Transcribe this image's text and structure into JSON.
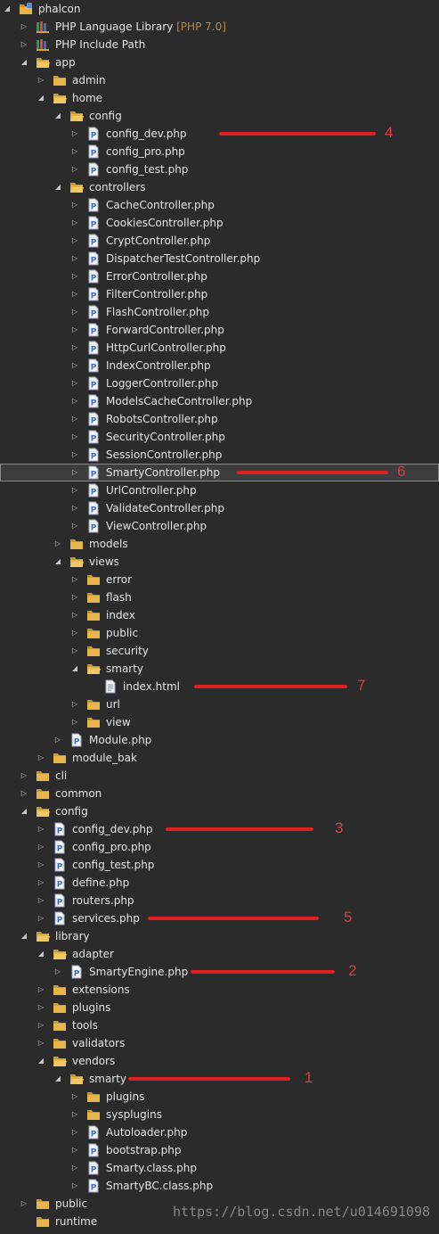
{
  "tree": [
    {
      "label": "phalcon",
      "depth": 0,
      "arrow": "open",
      "icon": "project"
    },
    {
      "label": "PHP Language Library",
      "extra": "[PHP 7.0]",
      "depth": 1,
      "arrow": "closed",
      "icon": "library"
    },
    {
      "label": "PHP Include Path",
      "depth": 1,
      "arrow": "closed",
      "icon": "library"
    },
    {
      "label": "app",
      "depth": 1,
      "arrow": "open",
      "icon": "folder-open"
    },
    {
      "label": "admin",
      "depth": 2,
      "arrow": "closed",
      "icon": "folder"
    },
    {
      "label": "home",
      "depth": 2,
      "arrow": "open",
      "icon": "folder-open"
    },
    {
      "label": "config",
      "depth": 3,
      "arrow": "open",
      "icon": "folder-open"
    },
    {
      "label": "config_dev.php",
      "depth": 4,
      "arrow": "closed",
      "icon": "php"
    },
    {
      "label": "config_pro.php",
      "depth": 4,
      "arrow": "closed",
      "icon": "php"
    },
    {
      "label": "config_test.php",
      "depth": 4,
      "arrow": "closed",
      "icon": "php"
    },
    {
      "label": "controllers",
      "depth": 3,
      "arrow": "open",
      "icon": "folder-open"
    },
    {
      "label": "CacheController.php",
      "depth": 4,
      "arrow": "closed",
      "icon": "php"
    },
    {
      "label": "CookiesController.php",
      "depth": 4,
      "arrow": "closed",
      "icon": "php"
    },
    {
      "label": "CryptController.php",
      "depth": 4,
      "arrow": "closed",
      "icon": "php"
    },
    {
      "label": "DispatcherTestController.php",
      "depth": 4,
      "arrow": "closed",
      "icon": "php"
    },
    {
      "label": "ErrorController.php",
      "depth": 4,
      "arrow": "closed",
      "icon": "php"
    },
    {
      "label": "FilterController.php",
      "depth": 4,
      "arrow": "closed",
      "icon": "php"
    },
    {
      "label": "FlashController.php",
      "depth": 4,
      "arrow": "closed",
      "icon": "php"
    },
    {
      "label": "ForwardController.php",
      "depth": 4,
      "arrow": "closed",
      "icon": "php"
    },
    {
      "label": "HttpCurlController.php",
      "depth": 4,
      "arrow": "closed",
      "icon": "php"
    },
    {
      "label": "IndexController.php",
      "depth": 4,
      "arrow": "closed",
      "icon": "php"
    },
    {
      "label": "LoggerController.php",
      "depth": 4,
      "arrow": "closed",
      "icon": "php"
    },
    {
      "label": "ModelsCacheController.php",
      "depth": 4,
      "arrow": "closed",
      "icon": "php"
    },
    {
      "label": "RobotsController.php",
      "depth": 4,
      "arrow": "closed",
      "icon": "php"
    },
    {
      "label": "SecurityController.php",
      "depth": 4,
      "arrow": "closed",
      "icon": "php"
    },
    {
      "label": "SessionController.php",
      "depth": 4,
      "arrow": "closed",
      "icon": "php"
    },
    {
      "label": "SmartyController.php",
      "depth": 4,
      "arrow": "closed",
      "icon": "php",
      "selected": true
    },
    {
      "label": "UrlController.php",
      "depth": 4,
      "arrow": "closed",
      "icon": "php"
    },
    {
      "label": "ValidateController.php",
      "depth": 4,
      "arrow": "closed",
      "icon": "php"
    },
    {
      "label": "ViewController.php",
      "depth": 4,
      "arrow": "closed",
      "icon": "php"
    },
    {
      "label": "models",
      "depth": 3,
      "arrow": "closed",
      "icon": "folder"
    },
    {
      "label": "views",
      "depth": 3,
      "arrow": "open",
      "icon": "folder-open"
    },
    {
      "label": "error",
      "depth": 4,
      "arrow": "closed",
      "icon": "folder"
    },
    {
      "label": "flash",
      "depth": 4,
      "arrow": "closed",
      "icon": "folder"
    },
    {
      "label": "index",
      "depth": 4,
      "arrow": "closed",
      "icon": "folder"
    },
    {
      "label": "public",
      "depth": 4,
      "arrow": "closed",
      "icon": "folder"
    },
    {
      "label": "security",
      "depth": 4,
      "arrow": "closed",
      "icon": "folder"
    },
    {
      "label": "smarty",
      "depth": 4,
      "arrow": "open",
      "icon": "folder-open"
    },
    {
      "label": "index.html",
      "depth": 5,
      "arrow": "none",
      "icon": "html"
    },
    {
      "label": "url",
      "depth": 4,
      "arrow": "closed",
      "icon": "folder"
    },
    {
      "label": "view",
      "depth": 4,
      "arrow": "closed",
      "icon": "folder"
    },
    {
      "label": "Module.php",
      "depth": 3,
      "arrow": "closed",
      "icon": "php"
    },
    {
      "label": "module_bak",
      "depth": 2,
      "arrow": "closed",
      "icon": "folder"
    },
    {
      "label": "cli",
      "depth": 1,
      "arrow": "closed",
      "icon": "folder"
    },
    {
      "label": "common",
      "depth": 1,
      "arrow": "closed",
      "icon": "folder"
    },
    {
      "label": "config",
      "depth": 1,
      "arrow": "open",
      "icon": "folder-open"
    },
    {
      "label": "config_dev.php",
      "depth": 2,
      "arrow": "closed",
      "icon": "php"
    },
    {
      "label": "config_pro.php",
      "depth": 2,
      "arrow": "closed",
      "icon": "php"
    },
    {
      "label": "config_test.php",
      "depth": 2,
      "arrow": "closed",
      "icon": "php"
    },
    {
      "label": "define.php",
      "depth": 2,
      "arrow": "closed",
      "icon": "php"
    },
    {
      "label": "routers.php",
      "depth": 2,
      "arrow": "closed",
      "icon": "php"
    },
    {
      "label": "services.php",
      "depth": 2,
      "arrow": "closed",
      "icon": "php"
    },
    {
      "label": "library",
      "depth": 1,
      "arrow": "open",
      "icon": "folder-open"
    },
    {
      "label": "adapter",
      "depth": 2,
      "arrow": "open",
      "icon": "folder-open"
    },
    {
      "label": "SmartyEngine.php",
      "depth": 3,
      "arrow": "closed",
      "icon": "php"
    },
    {
      "label": "extensions",
      "depth": 2,
      "arrow": "closed",
      "icon": "folder"
    },
    {
      "label": "plugins",
      "depth": 2,
      "arrow": "closed",
      "icon": "folder"
    },
    {
      "label": "tools",
      "depth": 2,
      "arrow": "closed",
      "icon": "folder"
    },
    {
      "label": "validators",
      "depth": 2,
      "arrow": "closed",
      "icon": "folder"
    },
    {
      "label": "vendors",
      "depth": 2,
      "arrow": "open",
      "icon": "folder-open"
    },
    {
      "label": "smarty",
      "depth": 3,
      "arrow": "open",
      "icon": "folder-open"
    },
    {
      "label": "plugins",
      "depth": 4,
      "arrow": "closed",
      "icon": "folder"
    },
    {
      "label": "sysplugins",
      "depth": 4,
      "arrow": "closed",
      "icon": "folder"
    },
    {
      "label": "Autoloader.php",
      "depth": 4,
      "arrow": "closed",
      "icon": "php"
    },
    {
      "label": "bootstrap.php",
      "depth": 4,
      "arrow": "closed",
      "icon": "php"
    },
    {
      "label": "Smarty.class.php",
      "depth": 4,
      "arrow": "closed",
      "icon": "php"
    },
    {
      "label": "SmartyBC.class.php",
      "depth": 4,
      "arrow": "closed",
      "icon": "php"
    },
    {
      "label": "public",
      "depth": 1,
      "arrow": "closed",
      "icon": "folder"
    },
    {
      "label": "runtime",
      "depth": 1,
      "arrow": "none",
      "icon": "folder"
    }
  ],
  "annotations": [
    {
      "row": 7,
      "number": "4"
    },
    {
      "row": 26,
      "number": "6"
    },
    {
      "row": 38,
      "number": "7"
    },
    {
      "row": 46,
      "number": "3"
    },
    {
      "row": 51,
      "number": "5"
    },
    {
      "row": 54,
      "number": "2"
    },
    {
      "row": 60,
      "number": "1"
    }
  ],
  "watermark": "https://blog.csdn.net/u014691098",
  "colors": {
    "background": "#2b2b2b",
    "selection": "#3d3d3d",
    "annotation_red": "#e02020",
    "folder": "#e8b54a",
    "php_icon": "#4a7bd0"
  }
}
